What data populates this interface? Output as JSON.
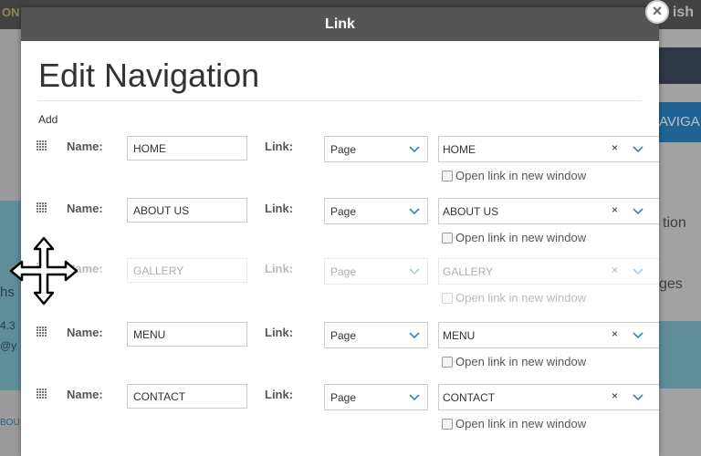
{
  "background": {
    "top_left_text": "ON",
    "top_right_text": "ish",
    "right_nav_label": "AVIGA",
    "right_text_1": "tion",
    "right_text_2": "ges",
    "left_text_1": "hs",
    "left_text_2": "4.3",
    "left_text_3": "@y",
    "left_text_4": "BOU"
  },
  "modal": {
    "header_title": "Link",
    "close_symbol": "×",
    "page_title": "Edit Navigation",
    "add_label": "Add",
    "name_label": "Name:",
    "link_label": "Link:",
    "open_new_window_label": "Open link in new window",
    "clear_symbol": "×",
    "rows": [
      {
        "name": "HOME",
        "link_type": "Page",
        "target": "HOME",
        "disabled": false
      },
      {
        "name": "ABOUT US",
        "link_type": "Page",
        "target": "ABOUT US",
        "disabled": false
      },
      {
        "name": "GALLERY",
        "link_type": "Page",
        "target": "GALLERY",
        "disabled": true
      },
      {
        "name": "MENU",
        "link_type": "Page",
        "target": "MENU",
        "disabled": false
      },
      {
        "name": "CONTACT",
        "link_type": "Page",
        "target": "CONTACT",
        "disabled": false
      }
    ]
  },
  "colors": {
    "header_bg": "#555555",
    "accent_chevron": "#2b86c5"
  },
  "cursor": {
    "icon": "move-cursor-icon"
  }
}
